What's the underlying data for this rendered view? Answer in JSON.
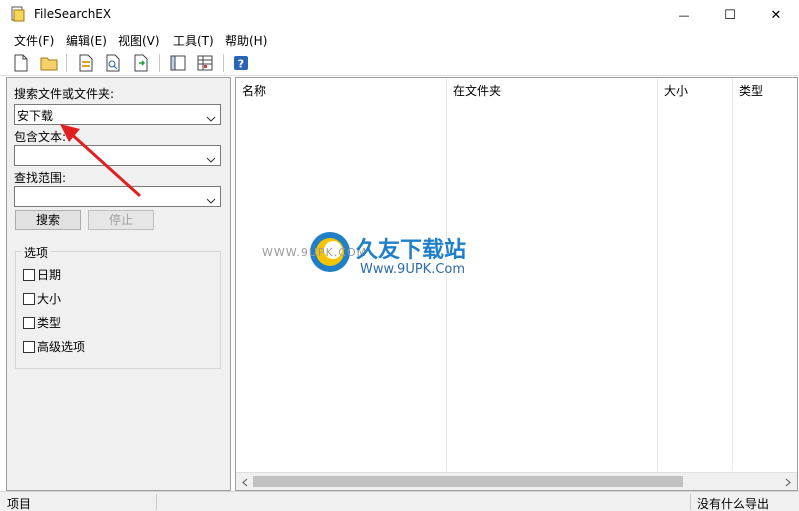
{
  "window": {
    "title": "FileSearchEX",
    "minimize_glyph": "—",
    "maximize_glyph": "☐",
    "close_glyph": "✕"
  },
  "menu": [
    {
      "label": "文件(F)"
    },
    {
      "label": "编辑(E)"
    },
    {
      "label": "视图(V)"
    },
    {
      "label": "工具(T)"
    },
    {
      "label": "帮助(H)"
    }
  ],
  "toolbar": {
    "icons": [
      "new-file-icon",
      "open-folder-icon",
      "document-icon",
      "preview-icon",
      "export-icon",
      "panel-icon",
      "grid-icon",
      "help-icon"
    ]
  },
  "search": {
    "name_label": "搜索文件或文件夹:",
    "name_value": "安下载",
    "text_label": "包含文本:",
    "text_value": "",
    "scope_label": "查找范围:",
    "scope_value": "",
    "search_button": "搜索",
    "stop_button": "停止"
  },
  "options": {
    "title": "选项",
    "items": [
      {
        "label": "日期",
        "checked": false
      },
      {
        "label": "大小",
        "checked": false
      },
      {
        "label": "类型",
        "checked": false
      },
      {
        "label": "高级选项",
        "checked": false
      }
    ]
  },
  "results": {
    "columns": [
      "名称",
      "在文件夹",
      "大小",
      "类型"
    ]
  },
  "watermark": {
    "brand": "久友下载站",
    "url": "Www.9UPK.Com",
    "left_text": "WWW.9UPK.COM"
  },
  "status": {
    "left": "项目",
    "right": "没有什么导出"
  },
  "colors": {
    "annotation_arrow": "#e02020",
    "watermark_blue": "#1f7fc8"
  }
}
